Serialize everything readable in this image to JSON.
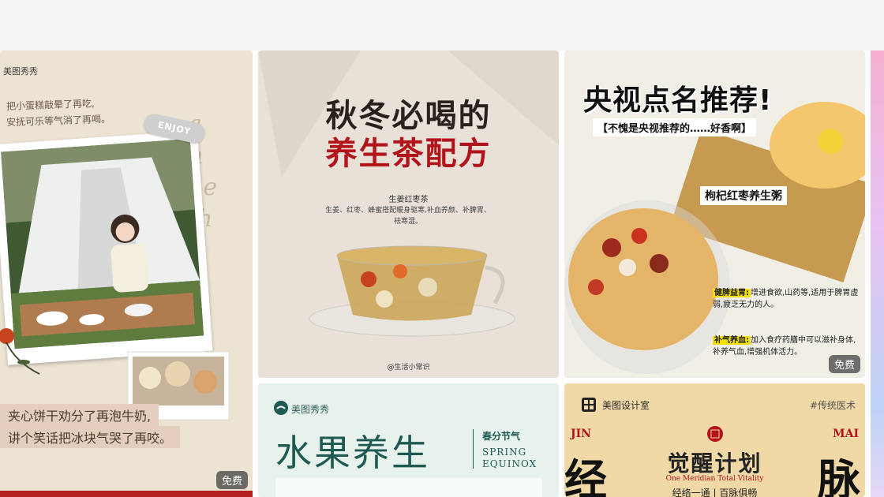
{
  "free_tag": "免费",
  "card1": {
    "brand": "美图秀秀",
    "note_lines": [
      "把小蛋糕敲晕了再吃,",
      "安抚可乐等气消了再喝。"
    ],
    "sticker": "ENJOY",
    "script_text": [
      "a",
      "n",
      "he",
      "th",
      "e"
    ],
    "caption_lines": [
      "夹心饼干劝分了再泡牛奶,",
      "讲个笑话把冰块气哭了再咬。"
    ]
  },
  "card2": {
    "title_line1": "秋冬必喝的",
    "title_line2": "养生茶配方",
    "recipe_name": "生姜红枣茶",
    "description": "生姜、红枣、蜂蜜搭配暖身驱寒,补血养颜、补脾胃、祛寒湿。",
    "credit": "@生活小常识"
  },
  "card3": {
    "title": "央视点名推荐!",
    "subtitle": "【不愧是央视推荐的……好香啊】",
    "dish_label": "枸杞红枣养生粥",
    "points": [
      {
        "head": "健脾益胃:",
        "text": "增进食欲,山药等,适用于脾胃虚弱,疲乏无力的人。"
      },
      {
        "head": "补气养血:",
        "text": "加入食疗药膳中可以滋补身体,补养气血,增强机体活力。"
      }
    ]
  },
  "card4": {
    "brand": "美图秀秀",
    "title": "水果养生",
    "season_cn": "春分节气",
    "season_en_1": "SPRING",
    "season_en_2": "EQUINOX"
  },
  "card5": {
    "brand": "美图设计室",
    "hashtag": "#传统医术",
    "left_en": "JIN",
    "right_en": "MAI",
    "left_big": "经",
    "right_big": "脉",
    "title": "觉醒计划",
    "subtitle_en": "One Meridian Total Vitality",
    "subtitle_cn": "经络一通 | 百脉俱畅"
  }
}
